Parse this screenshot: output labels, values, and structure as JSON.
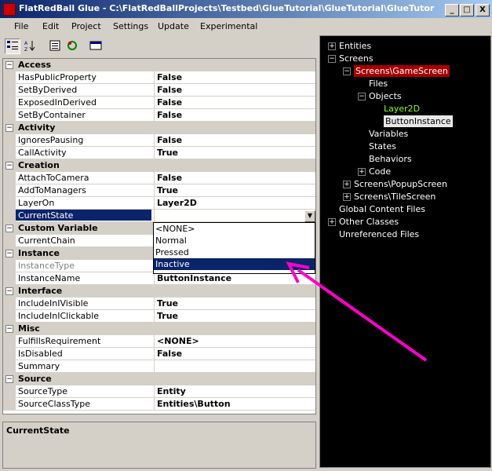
{
  "window": {
    "title": "FlatRedBall Glue - C:\\FlatRedBallProjects\\Testbed\\GlueTutorial\\GlueTutorial\\GlueTutorial.csproj",
    "minimize": "_",
    "maximize": "□",
    "close": "X"
  },
  "menu": [
    "File",
    "Edit",
    "Project",
    "Settings",
    "Update",
    "Experimental"
  ],
  "toolbar": {
    "icons": [
      "categorized-icon",
      "alphabetical-icon",
      "property-pages-icon",
      "refresh-icon",
      "window-icon"
    ]
  },
  "properties": [
    {
      "category": "Access",
      "rows": [
        {
          "name": "HasPublicProperty",
          "value": "False"
        },
        {
          "name": "SetByDerived",
          "value": "False"
        },
        {
          "name": "ExposedInDerived",
          "value": "False"
        },
        {
          "name": "SetByContainer",
          "value": "False"
        }
      ]
    },
    {
      "category": "Activity",
      "rows": [
        {
          "name": "IgnoresPausing",
          "value": "False"
        },
        {
          "name": "CallActivity",
          "value": "True"
        }
      ]
    },
    {
      "category": "Creation",
      "rows": [
        {
          "name": "AttachToCamera",
          "value": "False"
        },
        {
          "name": "AddToManagers",
          "value": "True"
        },
        {
          "name": "LayerOn",
          "value": "Layer2D"
        },
        {
          "name": "CurrentState",
          "value": ""
        }
      ]
    },
    {
      "category": "Custom Variable",
      "rows": [
        {
          "name": "CurrentChain",
          "value": ""
        }
      ]
    },
    {
      "category": "Instance",
      "rows": [
        {
          "name": "InstanceType",
          "value": ""
        },
        {
          "name": "InstanceName",
          "value": "ButtonInstance"
        }
      ]
    },
    {
      "category": "Interface",
      "rows": [
        {
          "name": "IncludeInIVisible",
          "value": "True"
        },
        {
          "name": "IncludeInIClickable",
          "value": "True"
        }
      ]
    },
    {
      "category": "Misc",
      "rows": [
        {
          "name": "FulfillsRequirement",
          "value": "<NONE>"
        },
        {
          "name": "IsDisabled",
          "value": "False"
        },
        {
          "name": "Summary",
          "value": ""
        }
      ]
    },
    {
      "category": "Source",
      "rows": [
        {
          "name": "SourceType",
          "value": "Entity"
        },
        {
          "name": "SourceClassType",
          "value": "Entities\\Button"
        }
      ]
    }
  ],
  "dropdown": {
    "options": [
      "<NONE>",
      "Normal",
      "Pressed",
      "Inactive"
    ],
    "selected": "Inactive",
    "button": "▼"
  },
  "description": {
    "title": "CurrentState"
  },
  "tree": [
    {
      "label": "Entities",
      "depth": 0,
      "expander": "+"
    },
    {
      "label": "Screens",
      "depth": 0,
      "expander": "−"
    },
    {
      "label": "Screens\\GameScreen",
      "depth": 1,
      "expander": "−",
      "style": "red"
    },
    {
      "label": "Files",
      "depth": 2,
      "expander": ""
    },
    {
      "label": "Objects",
      "depth": 2,
      "expander": "−"
    },
    {
      "label": "Layer2D",
      "depth": 3,
      "expander": "",
      "style": "green"
    },
    {
      "label": "ButtonInstance",
      "depth": 3,
      "expander": "",
      "style": "white"
    },
    {
      "label": "Variables",
      "depth": 2,
      "expander": ""
    },
    {
      "label": "States",
      "depth": 2,
      "expander": ""
    },
    {
      "label": "Behaviors",
      "depth": 2,
      "expander": ""
    },
    {
      "label": "Code",
      "depth": 2,
      "expander": "+"
    },
    {
      "label": "Screens\\PopupScreen",
      "depth": 1,
      "expander": "+"
    },
    {
      "label": "Screens\\TileScreen",
      "depth": 1,
      "expander": "+"
    },
    {
      "label": "Global Content Files",
      "depth": 0,
      "expander": ""
    },
    {
      "label": "Other Classes",
      "depth": 0,
      "expander": "+"
    },
    {
      "label": "Unreferenced Files",
      "depth": 0,
      "expander": ""
    }
  ],
  "colors": {
    "arrow": "#ff00cc",
    "selection": "#0a246a",
    "tree_highlight": "#a80000",
    "tree_green": "#8fff00"
  }
}
